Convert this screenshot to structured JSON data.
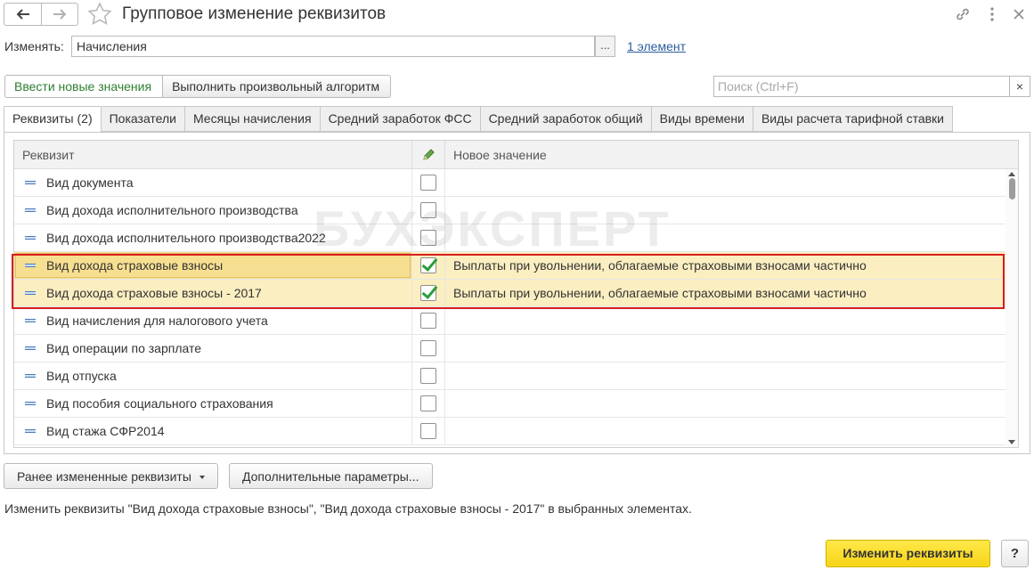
{
  "window": {
    "title": "Групповое изменение реквизитов",
    "icons": [
      "back-arrow-icon",
      "forward-arrow-icon",
      "star-icon",
      "link-icon",
      "more-icon",
      "close-icon"
    ]
  },
  "object": {
    "label": "Изменять:",
    "value": "Начисления",
    "select_button": "...",
    "count_link": "1 элемент"
  },
  "command_bar": {
    "enter_values": "Ввести новые значения",
    "run_algorithm": "Выполнить произвольный алгоритм",
    "search_placeholder": "Поиск (Ctrl+F)",
    "search_clear": "×"
  },
  "tabs": [
    {
      "label": "Реквизиты (2)",
      "active": true
    },
    {
      "label": "Показатели",
      "active": false
    },
    {
      "label": "Месяцы начисления",
      "active": false
    },
    {
      "label": "Средний заработок ФСС",
      "active": false
    },
    {
      "label": "Средний заработок общий",
      "active": false
    },
    {
      "label": "Виды времени",
      "active": false
    },
    {
      "label": "Виды расчета тарифной ставки",
      "active": false
    }
  ],
  "table": {
    "columns": [
      "Реквизит",
      "",
      "Новое значение"
    ],
    "edit_column_icon": "pencil-icon",
    "rows": [
      {
        "attribute": "Вид документа",
        "checked": false,
        "new_value": ""
      },
      {
        "attribute": "Вид дохода исполнительного производства",
        "checked": false,
        "new_value": ""
      },
      {
        "attribute": "Вид дохода исполнительного производства2022",
        "checked": false,
        "new_value": ""
      },
      {
        "attribute": "Вид дохода страховые взносы",
        "checked": true,
        "new_value": "Выплаты при увольнении, облагаемые страховыми взносами частично"
      },
      {
        "attribute": "Вид дохода страховые взносы - 2017",
        "checked": true,
        "new_value": "Выплаты при увольнении, облагаемые страховыми взносами частично"
      },
      {
        "attribute": "Вид начисления для налогового учета",
        "checked": false,
        "new_value": ""
      },
      {
        "attribute": "Вид операции по зарплате",
        "checked": false,
        "new_value": ""
      },
      {
        "attribute": "Вид отпуска",
        "checked": false,
        "new_value": ""
      },
      {
        "attribute": "Вид пособия социального страхования",
        "checked": false,
        "new_value": ""
      },
      {
        "attribute": "Вид стажа  СФР2014",
        "checked": false,
        "new_value": ""
      }
    ]
  },
  "watermark": "БУХЭКСПЕРТ",
  "bottom": {
    "prev_changed": "Ранее измененные реквизиты",
    "extra_params": "Дополнительные параметры...",
    "info_text": "Изменить реквизиты \"Вид дохода страховые взносы\", \"Вид дохода страховые взносы - 2017\" в выбранных элементах.",
    "apply": "Изменить реквизиты",
    "help": "?"
  },
  "colors": {
    "accent_yellow": "#f7d416",
    "selection_row": "#fbeec1",
    "highlight_frame": "#d81e1e",
    "check_green": "#2a9c3d",
    "link_blue": "#2b5c9f"
  }
}
